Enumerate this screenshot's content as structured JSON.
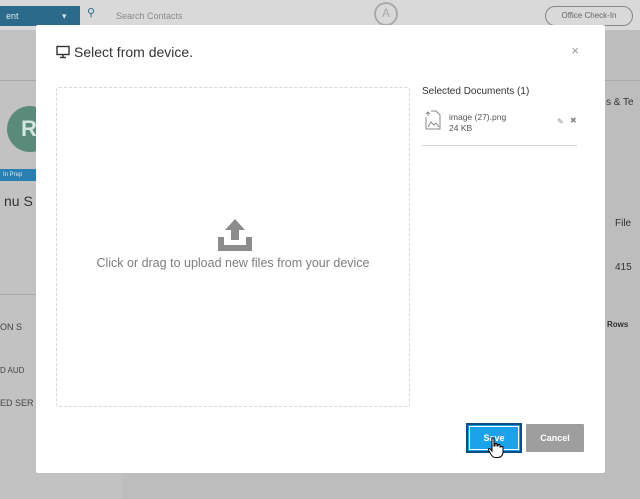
{
  "background": {
    "menu_label": "ent",
    "search_placeholder": "Search Contacts",
    "logo_letter": "A",
    "checkin_label": "Office Check-In",
    "avatar_initial": "R",
    "status_badge": "In Prep",
    "contact_name": "nu S",
    "left_snippets": [
      "ON S",
      "D AUD",
      "ED SER"
    ],
    "right_snippets": [
      "s & Te",
      "File",
      "415",
      "Rows"
    ]
  },
  "modal": {
    "title": "Select from device.",
    "dropzone_text": "Click or drag to upload new files from your device",
    "selected_heading": "Selected Documents (1)",
    "documents": [
      {
        "name": "image (27).png",
        "size": "24 KB"
      }
    ],
    "save_label": "Save",
    "cancel_label": "Cancel",
    "close_symbol": "×"
  },
  "colors": {
    "save": "#1aa3e8",
    "cancel": "#9e9e9e",
    "overlay": "#bdbdbd"
  }
}
